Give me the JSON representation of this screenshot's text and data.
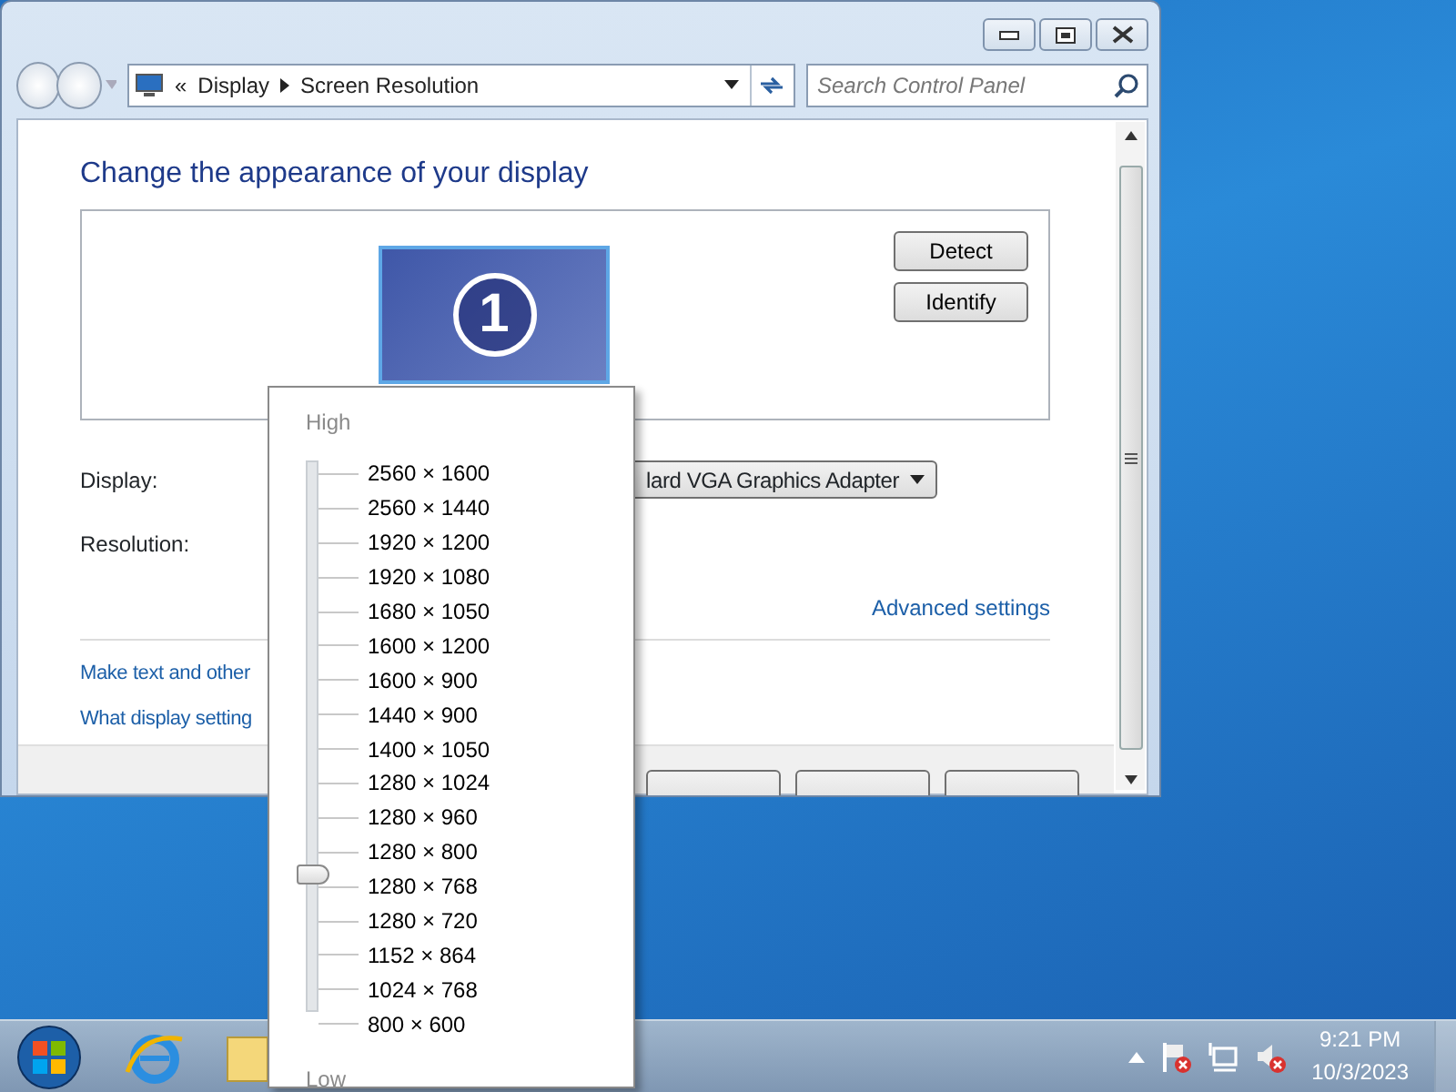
{
  "window": {
    "address": {
      "back": "«",
      "crumbs": [
        "Display",
        "Screen Resolution"
      ]
    },
    "search": {
      "placeholder": "Search Control Panel"
    },
    "heading": "Change the appearance of your display",
    "monitor": {
      "number": "1"
    },
    "buttons": [
      "Detect",
      "Identify"
    ],
    "fields": [
      {
        "label": "Display:",
        "value": "lard VGA Graphics Adapter"
      },
      {
        "label": "Resolution:"
      }
    ],
    "advanced_link": "Advanced settings",
    "links": [
      "Make text and other",
      "What display setting"
    ]
  },
  "resolution_popup": {
    "high": "High",
    "low": "Low",
    "level": 0.25,
    "options": [
      "2560 × 1600",
      "2560 × 1440",
      "1920 × 1200",
      "1920 × 1080",
      "1680 × 1050",
      "1600 × 1200",
      "1600 × 900",
      "1440 × 900",
      "1400 × 1050",
      "1280 × 1024",
      "1280 × 960",
      "1280 × 800",
      "1280 × 768",
      "1280 × 720",
      "1152 × 864",
      "1024 × 768",
      "800 × 600"
    ]
  },
  "taskbar": {
    "time": "9:21 PM",
    "date": "10/3/2023"
  }
}
